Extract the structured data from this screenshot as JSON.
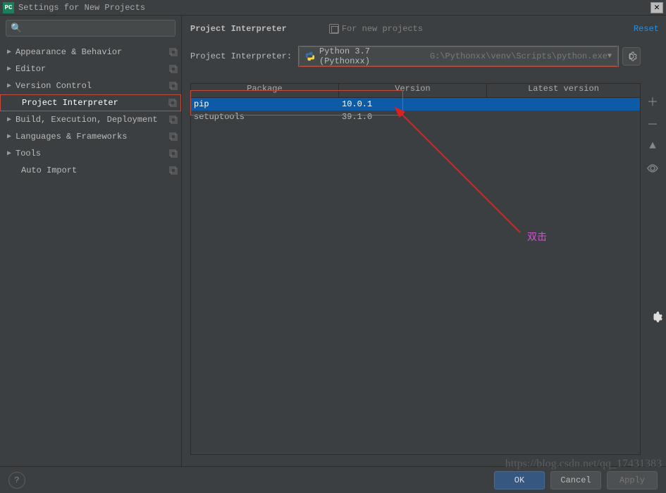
{
  "window": {
    "title": "Settings for New Projects",
    "pc_label": "PC"
  },
  "sidebar": {
    "search_placeholder": "",
    "items": [
      {
        "label": "Appearance & Behavior",
        "expandable": true
      },
      {
        "label": "Editor",
        "expandable": true
      },
      {
        "label": "Version Control",
        "expandable": true
      },
      {
        "label": "Project Interpreter",
        "expandable": false,
        "selected": true,
        "child": true
      },
      {
        "label": "Build, Execution, Deployment",
        "expandable": true
      },
      {
        "label": "Languages & Frameworks",
        "expandable": true
      },
      {
        "label": "Tools",
        "expandable": true
      },
      {
        "label": "Auto Import",
        "expandable": false,
        "child": true
      }
    ]
  },
  "header": {
    "title": "Project Interpreter",
    "sub": "For new projects",
    "reset": "Reset"
  },
  "interpreter": {
    "label": "Project Interpreter:",
    "name": "Python 3.7 (Pythonxx)",
    "path": "G:\\Pythonxx\\venv\\Scripts\\python.exe"
  },
  "packages": {
    "cols": {
      "pkg": "Package",
      "ver": "Version",
      "lat": "Latest version"
    },
    "rows": [
      {
        "pkg": "pip",
        "ver": "10.0.1",
        "lat": "",
        "selected": true
      },
      {
        "pkg": "setuptools",
        "ver": "39.1.0",
        "lat": ""
      }
    ]
  },
  "annotation": {
    "text": "双击"
  },
  "footer": {
    "ok": "OK",
    "cancel": "Cancel",
    "apply": "Apply"
  },
  "watermark": "https://blog.csdn.net/qq_17431383"
}
